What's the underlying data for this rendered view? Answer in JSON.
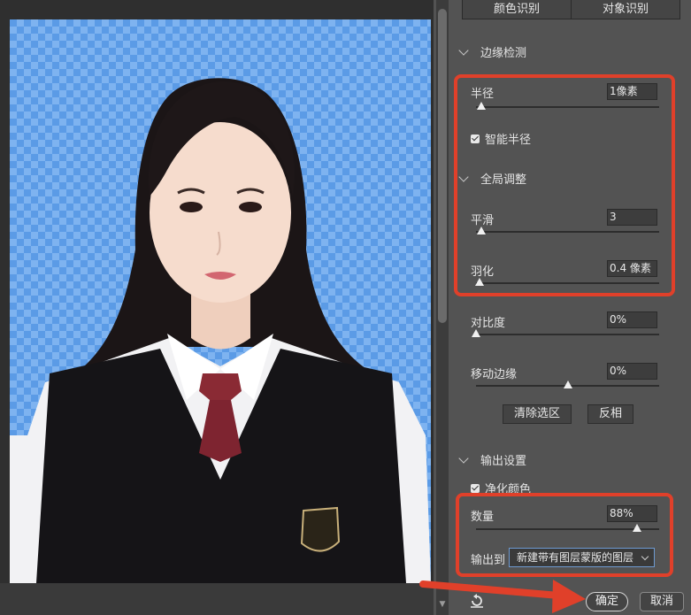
{
  "panel": {
    "tabs": [
      "颜色识别",
      "对象识别"
    ],
    "edge_detection": {
      "title": "边缘检测",
      "radius_label": "半径",
      "radius_value": "1像素",
      "radius_level": 0.03,
      "smart_radius_label": "智能半径",
      "smart_radius_checked": true
    },
    "global_adjust": {
      "title": "全局调整",
      "smooth_label": "平滑",
      "smooth_value": "3",
      "smooth_level": 0.03,
      "feather_label": "羽化",
      "feather_value": "0.4 像素",
      "feather_level": 0.02,
      "contrast_label": "对比度",
      "contrast_value": "0%",
      "contrast_level": 0.0,
      "shift_edge_label": "移动边缘",
      "shift_edge_value": "0%",
      "shift_edge_level": 0.5,
      "clear_selection_label": "清除选区",
      "invert_label": "反相"
    },
    "output": {
      "title": "输出设置",
      "decontaminate_label": "净化颜色",
      "decontaminate_checked": true,
      "amount_label": "数量",
      "amount_value": "88%",
      "amount_level": 0.88,
      "output_to_label": "输出到",
      "output_to_value": "新建带有图层蒙版的图层"
    },
    "buttons": {
      "ok_label": "确定",
      "cancel_label": "取消"
    }
  },
  "colors": {
    "highlight": "#e0402a",
    "transparent_checker": "#5b9be6",
    "panel_bg": "#535353"
  }
}
